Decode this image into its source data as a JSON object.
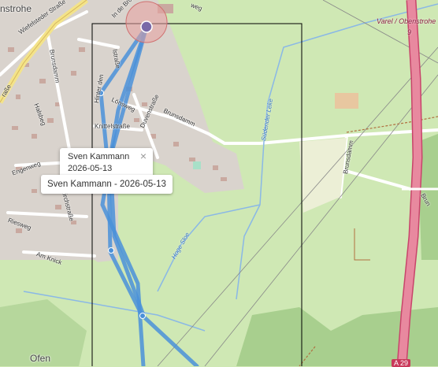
{
  "popup": {
    "name": "Sven Kammann",
    "date": "2026-05-13",
    "close_symbol": "×"
  },
  "tooltip": {
    "text": "Sven Kammann - 2026-05-13"
  },
  "places": {
    "town_fragment": "nstrohe",
    "town_bottom": "Ofen"
  },
  "roads": {
    "highway_label_1": "Varel / Obenstrohe",
    "highway_label_2": "9",
    "highway_number": "A 29"
  },
  "streets": {
    "wiefelsteder": "Wiefelsteder Straße",
    "strasse_left": "raße",
    "brunsdamm_top": "Brunsdamm",
    "brunsdamm_mid": "Brunsdamm",
    "brunsdamm_right": "Brunsdamm",
    "brunsdamm_edge": "Brun",
    "hinter_den": "Hinter den",
    "in_de_brok": "In de Brok",
    "loni": "Lönsweg",
    "duvenstrasse": "Duvenstraße",
    "knittelstrasse": "Knittelstraße",
    "halsbeg": "Halsbeg",
    "engenweg": "Engenweg",
    "kirchstrasse": "Kirchstraße",
    "riesweg": "Riesweg",
    "am_knick": "Am Knick",
    "weg_top": "weg",
    "strasse_small": "lstraße"
  },
  "waterways": {
    "suedender_leke": "Südender Leke",
    "hoge_sloe": "Hoge Sloe"
  },
  "colors": {
    "track": "#4a90d9",
    "highway": "#e8899f",
    "forest": "#a8cf8e",
    "residential": "#d9d3cd",
    "water": "#8ab8e6",
    "bbox": "#000000"
  }
}
